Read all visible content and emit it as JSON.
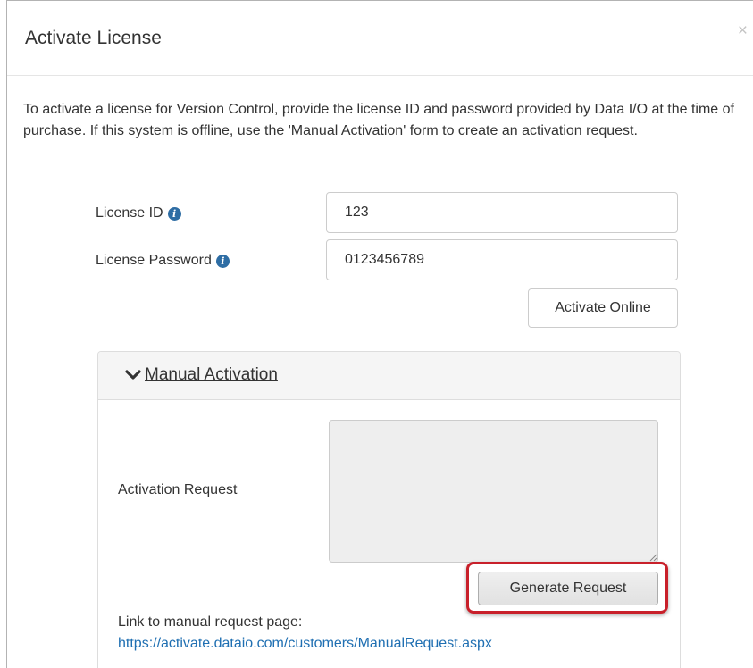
{
  "dialog": {
    "title": "Activate License",
    "close_glyph": "×",
    "intro_text": "To activate a license for Version Control, provide the license ID and password provided by Data I/O at the time of purchase. If this system is offline, use the 'Manual Activation' form to create an activation request."
  },
  "form": {
    "license_id": {
      "label": "License ID",
      "value": "123",
      "icon": "info-icon"
    },
    "license_password": {
      "label": "License Password",
      "value": "0123456789",
      "icon": "info-icon"
    },
    "activate_online_label": "Activate Online"
  },
  "manual_activation": {
    "title": "Manual Activation",
    "toggle_icon": "chevron-down-icon",
    "activation_request_label": "Activation Request",
    "activation_request_value": "",
    "generate_request_label": "Generate Request",
    "link_caption": "Link to manual request page:",
    "link_text": "https://activate.dataio.com/customers/ManualRequest.aspx"
  },
  "colors": {
    "info_icon": "#2e6da4",
    "link": "#1f6fb2",
    "highlight": "#c8202a",
    "panel_heading": "#f5f5f5",
    "textarea_bg": "#eeeeee"
  }
}
